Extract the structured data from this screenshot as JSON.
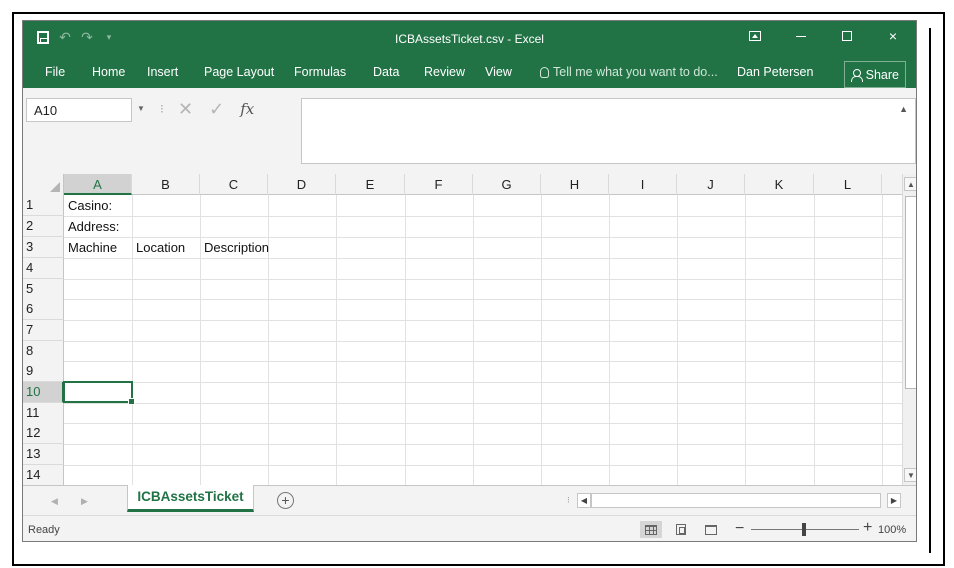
{
  "title": "ICBAssetsTicket.csv - Excel",
  "window_controls": {
    "ribbon_options": "ribbon-display-options-icon",
    "minimize": "minimize-icon",
    "maximize": "maximize-icon",
    "close": "×"
  },
  "ribbon_tabs": [
    "File",
    "Home",
    "Insert",
    "Page Layout",
    "Formulas",
    "Data",
    "Review",
    "View"
  ],
  "tell_me": "Tell me what you want to do...",
  "user": "Dan Petersen",
  "share": "Share",
  "formula_bar": {
    "name_box": "A10",
    "fx": "fx",
    "content": ""
  },
  "columns": [
    "A",
    "B",
    "C",
    "D",
    "E",
    "F",
    "G",
    "H",
    "I",
    "J",
    "K",
    "L"
  ],
  "rows": [
    "1",
    "2",
    "3",
    "4",
    "5",
    "6",
    "7",
    "8",
    "9",
    "10",
    "11",
    "12",
    "13",
    "14"
  ],
  "cells": {
    "A1": "Casino:",
    "A2": "Address:",
    "A3": "Machine",
    "B3": "Location",
    "C3": "Description"
  },
  "active_cell": "A10",
  "sheet_tabs": [
    "ICBAssetsTicket"
  ],
  "status": "Ready",
  "zoom": "100%",
  "colors": {
    "accent": "#217346"
  }
}
